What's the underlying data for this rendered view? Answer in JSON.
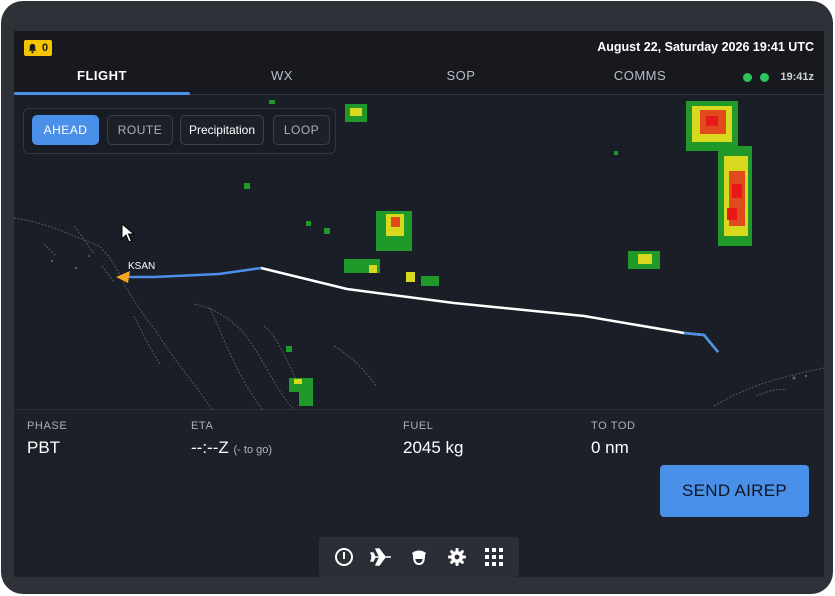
{
  "alerts": {
    "count": "0",
    "icon": "bell-icon",
    "color": "#f5c400"
  },
  "header": {
    "datetime": "August 22, Saturday 2026 19:41 UTC"
  },
  "tabs": [
    {
      "label": "FLIGHT",
      "active": true
    },
    {
      "label": "WX",
      "active": false
    },
    {
      "label": "SOP",
      "active": false
    },
    {
      "label": "COMMS",
      "active": false
    }
  ],
  "status": {
    "zulu_time": "19:41z",
    "indicator_color": "#2ec45c"
  },
  "map": {
    "modes": [
      "AHEAD",
      "ROUTE",
      "Precipitation",
      "LOOP"
    ],
    "active_mode": "AHEAD",
    "origin_label": "KSAN"
  },
  "info": {
    "phase_label": "PHASE",
    "phase_value": "PBT",
    "eta_label": "ETA",
    "eta_value": "--:--Z",
    "eta_suffix": "(- to go)",
    "fuel_label": "FUEL",
    "fuel_value": "2045 kg",
    "tod_label": "TO TOD",
    "tod_value": "0 nm"
  },
  "actions": {
    "send_airep": "SEND AIREP"
  },
  "toolbar": {
    "icons": [
      "compass-icon",
      "airplane-icon",
      "pilot-icon",
      "gear-icon",
      "grid-icon"
    ]
  },
  "colors": {
    "accent": "#4a90e8",
    "route_flown": "#4a90e8",
    "route_planned": "#ffffff",
    "aircraft": "#f5a623"
  }
}
